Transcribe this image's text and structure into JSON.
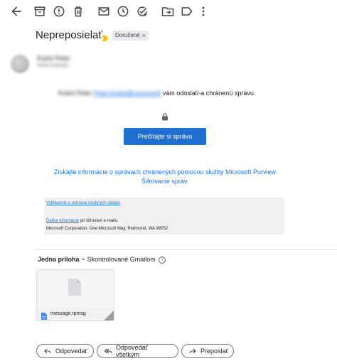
{
  "toolbar": {
    "icons": [
      "back-arrow-icon",
      "archive-icon",
      "report-spam-icon",
      "delete-icon",
      "mark-unread-icon",
      "snooze-icon",
      "add-to-tasks-icon",
      "move-to-icon",
      "label-icon",
      "more-vert-icon"
    ]
  },
  "message": {
    "subject": "Nepreposielať",
    "label_chip": "Doručené",
    "chip_close": "×",
    "sender_name": "Kubol Peter",
    "sender_email": "Peter.Kubol@...",
    "notice_name": "Kubol Peter",
    "notice_email": "Peter.Kubol@nexonsoft",
    "notice_text": "vám odoslal/-a chránenú správu.",
    "read_button": "Prečítajte si správu",
    "learn_more": "Získajte informácie o správach chránených pomocou služby Microsoft Purview Šifrovanie správ.",
    "privacy_link": "Vyhlásenie o ochrane osobných údajov",
    "info_link": "Ďalšie informácie",
    "info_suffix": " pri šifrovaní e-mailu.",
    "corp_address": "Microsoft Corporation. One Microsoft Way, Redmond, WA 98052"
  },
  "attachments": {
    "title": "Jedna príloha",
    "separator": "•",
    "scanned": "Skontrolované Gmailom",
    "info_glyph": "i",
    "file_name": "message.rpmsg"
  },
  "actions": {
    "reply": "Odpovedať",
    "reply_all": "Odpovedať všetkým",
    "forward": "Preposlať"
  },
  "colors": {
    "primary_button": "#1f6fd0",
    "link": "#1a73e8",
    "importance_marker": "#f4c20d"
  }
}
